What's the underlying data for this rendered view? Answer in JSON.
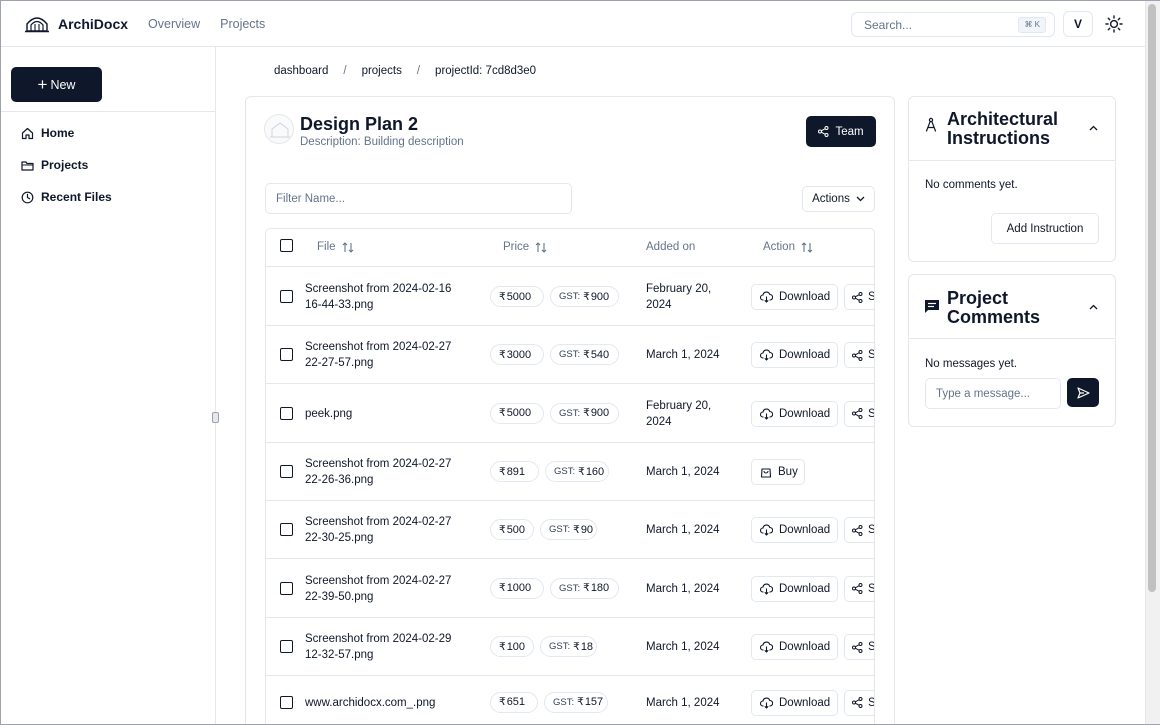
{
  "app": {
    "name": "ArchiDocx"
  },
  "topnav": {
    "items": [
      "Overview",
      "Projects"
    ]
  },
  "search": {
    "placeholder": "Search...",
    "shortcut": "⌘ K"
  },
  "user": {
    "avatar_letter": "V"
  },
  "sidebar": {
    "new_label": "New",
    "items": [
      {
        "label": "Home",
        "icon": "home-icon"
      },
      {
        "label": "Projects",
        "icon": "folder-icon"
      },
      {
        "label": "Recent Files",
        "icon": "clock-icon"
      }
    ]
  },
  "breadcrumb": [
    "dashboard",
    "projects",
    "projectId: 7cd8d3e0"
  ],
  "project": {
    "title": "Design Plan 2",
    "description": "Description: Building description",
    "team_label": "Team"
  },
  "filter": {
    "placeholder": "Filter Name..."
  },
  "actions_label": "Actions",
  "table": {
    "columns": [
      "File",
      "Price",
      "Added on",
      "Action"
    ],
    "gst_label": "GST:",
    "currency": "₹",
    "download_label": "Download",
    "share_label": "S",
    "buy_label": "Buy",
    "rows": [
      {
        "file_line1": "Screenshot from 2024-02-16",
        "file_line2": "16-44-33.png",
        "price": "5000",
        "gst": "900",
        "date_line1": "February 20,",
        "date_line2": "2024",
        "action": "download"
      },
      {
        "file_line1": "Screenshot from 2024-02-27",
        "file_line2": "22-27-57.png",
        "price": "3000",
        "gst": "540",
        "date_line1": "March 1, 2024",
        "date_line2": "",
        "action": "download"
      },
      {
        "file_line1": "peek.png",
        "file_line2": "",
        "price": "5000",
        "gst": "900",
        "date_line1": "February 20,",
        "date_line2": "2024",
        "action": "download"
      },
      {
        "file_line1": "Screenshot from 2024-02-27",
        "file_line2": "22-26-36.png",
        "price": "891",
        "gst": "160",
        "date_line1": "March 1, 2024",
        "date_line2": "",
        "action": "buy"
      },
      {
        "file_line1": "Screenshot from 2024-02-27",
        "file_line2": "22-30-25.png",
        "price": "500",
        "gst": "90",
        "date_line1": "March 1, 2024",
        "date_line2": "",
        "action": "download"
      },
      {
        "file_line1": "Screenshot from 2024-02-27",
        "file_line2": "22-39-50.png",
        "price": "1000",
        "gst": "180",
        "date_line1": "March 1, 2024",
        "date_line2": "",
        "action": "download"
      },
      {
        "file_line1": "Screenshot from 2024-02-29",
        "file_line2": "12-32-57.png",
        "price": "100",
        "gst": "18",
        "date_line1": "March 1, 2024",
        "date_line2": "",
        "action": "download"
      },
      {
        "file_line1": "www.archidocx.com_.png",
        "file_line2": "",
        "price": "651",
        "gst": "157",
        "date_line1": "March 1, 2024",
        "date_line2": "",
        "action": "download"
      }
    ]
  },
  "instructions_panel": {
    "title_line1": "Architectural",
    "title_line2": "Instructions",
    "empty_text": "No comments yet.",
    "add_label": "Add Instruction"
  },
  "comments_panel": {
    "title_line1": "Project",
    "title_line2": "Comments",
    "empty_text": "No messages yet.",
    "input_placeholder": "Type a message..."
  },
  "colors": {
    "primary": "#0f172a",
    "muted": "#64748b",
    "border": "#e5e7eb"
  }
}
